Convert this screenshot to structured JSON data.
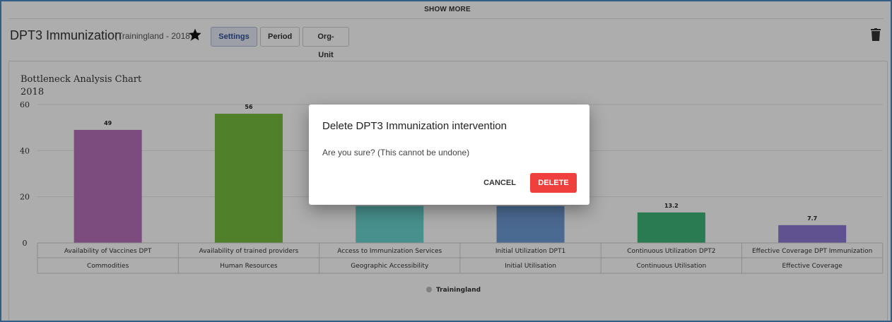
{
  "top_bar": {
    "show_more_label": "SHOW MORE"
  },
  "header": {
    "title": "DPT3 Immunization",
    "subtitle": "(Trainingland - 2018)",
    "buttons": {
      "settings": "Settings",
      "period": "Period",
      "orgunit": "Org-Unit"
    },
    "icons": {
      "favorite": "star-icon",
      "delete": "trash-icon"
    }
  },
  "chart_data": {
    "type": "bar",
    "title": "Bottleneck Analysis Chart",
    "subtitle": "2018",
    "categories": [
      "Availability of Vaccines DPT",
      "Availability of trained providers",
      "Access to Immunization Services",
      "Initial Utilization DPT1",
      "Continuous Utilization DPT2",
      "Effective Coverage DPT Immunization"
    ],
    "groups": [
      "Commodities",
      "Human Resources",
      "Geographic Accessibility",
      "Initial Utilisation",
      "Continuous Utilisation",
      "Effective Coverage"
    ],
    "series": [
      {
        "name": "Trainingland",
        "values": [
          49,
          56,
          null,
          null,
          13.2,
          7.7
        ]
      }
    ],
    "data_labels": [
      "49",
      "56",
      "",
      "",
      "13.2",
      "7.7"
    ],
    "visible_bar_values": [
      49,
      56,
      16,
      16,
      13.2,
      7.7
    ],
    "bar_colors": [
      "#b670b8",
      "#77bd3d",
      "#69d4d0",
      "#6f9dd6",
      "#3fb578",
      "#8e79d6"
    ],
    "y_ticks": [
      0,
      20,
      40,
      60
    ],
    "ylim": [
      0,
      60
    ],
    "grid": true,
    "legend_position": "bottom-center",
    "legend_color": "#bdbdbd"
  },
  "dialog": {
    "title": "Delete DPT3 Immunization intervention",
    "message": "Are you sure? (This cannot be undone)",
    "cancel_label": "CANCEL",
    "delete_label": "DELETE",
    "delete_color": "#f0403d"
  }
}
